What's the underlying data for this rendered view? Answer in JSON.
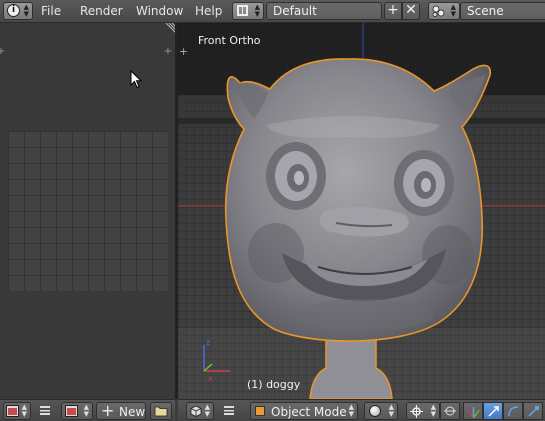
{
  "top_header": {
    "menus": [
      "File",
      "Render",
      "Window",
      "Help"
    ],
    "layout_name": "Default",
    "scene_name": "Scene"
  },
  "viewport": {
    "view_label": "Front Ortho",
    "object_label": "(1) doggy"
  },
  "left_header": {
    "new_label": "New"
  },
  "viewport_header": {
    "mode_label": "Object Mode"
  },
  "colors": {
    "selection_outline": "#e8962c",
    "active_tool": "#5b8fd8",
    "x_axis": "#c84444",
    "y_axis": "#6dbb3a",
    "z_axis": "#4a6fd8"
  }
}
